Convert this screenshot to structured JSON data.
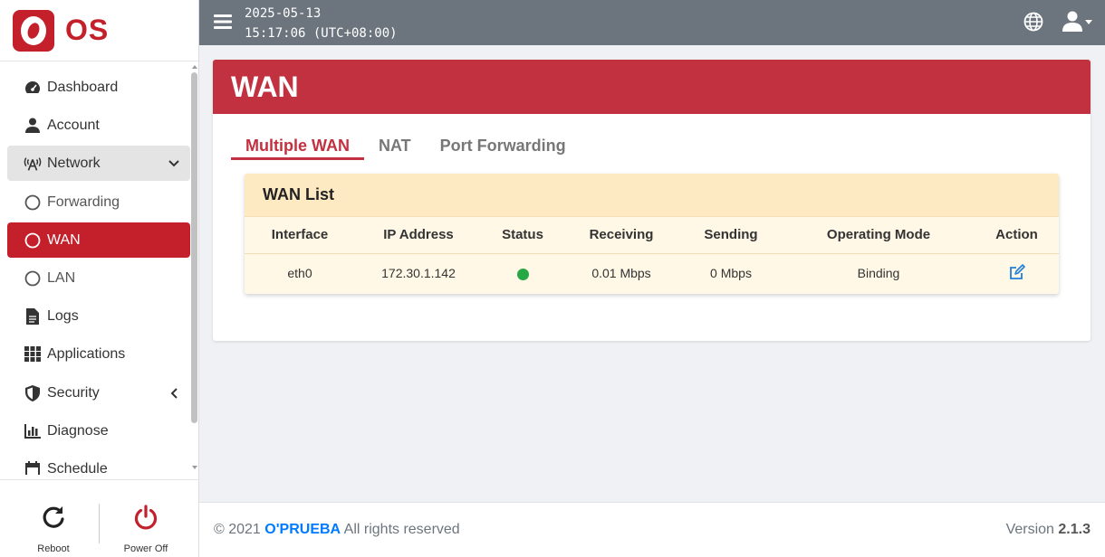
{
  "brand": {
    "name": "OS",
    "logo_letter": "O",
    "accent": "#c4202c"
  },
  "topbar": {
    "date": "2025-05-13",
    "time": "15:17:06 (UTC+08:00)"
  },
  "sidebar": {
    "items": [
      {
        "label": "Dashboard",
        "icon": "tachometer-icon"
      },
      {
        "label": "Account",
        "icon": "user-icon"
      },
      {
        "label": "Network",
        "icon": "antenna-icon",
        "state": "expanded"
      },
      {
        "label": "Forwarding",
        "icon": "circle-outline-icon",
        "sub": true
      },
      {
        "label": "WAN",
        "icon": "circle-outline-icon",
        "sub": true,
        "state": "active"
      },
      {
        "label": "LAN",
        "icon": "circle-outline-icon",
        "sub": true
      },
      {
        "label": "Logs",
        "icon": "file-icon"
      },
      {
        "label": "Applications",
        "icon": "grid-icon"
      },
      {
        "label": "Security",
        "icon": "shield-icon"
      },
      {
        "label": "Diagnose",
        "icon": "chart-icon"
      },
      {
        "label": "Schedule",
        "icon": "calendar-icon"
      }
    ],
    "reboot_label": "Reboot",
    "power_label": "Power Off"
  },
  "page": {
    "title": "WAN",
    "tabs": [
      "Multiple WAN",
      "NAT",
      "Port Forwarding"
    ],
    "active_tab": "Multiple WAN"
  },
  "wan_list": {
    "title": "WAN List",
    "columns": [
      "Interface",
      "IP Address",
      "Status",
      "Receiving",
      "Sending",
      "Operating Mode",
      "Action"
    ],
    "rows": [
      {
        "interface": "eth0",
        "ip": "172.30.1.142",
        "status": "online",
        "receiving": "0.01 Mbps",
        "sending": "0 Mbps",
        "mode": "Binding",
        "action_icon": "edit-icon"
      }
    ],
    "status_color": "#28a745"
  },
  "footer": {
    "copyright": "© 2021",
    "company": "O'PRUEBA",
    "rights": "All rights reserved",
    "version_label": "Version",
    "version": "2.1.3"
  }
}
